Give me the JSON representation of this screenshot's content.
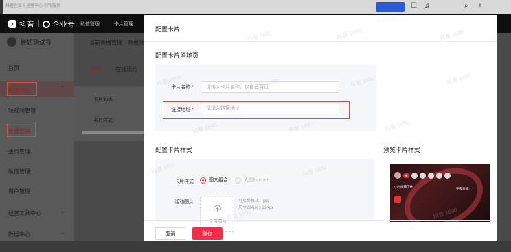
{
  "window": {
    "blurred_title": "抖音企业号运营中心-创作服务"
  },
  "topbar": {
    "app_name": "抖音",
    "product": "企业号",
    "nav": [
      "私信管理",
      "卡片管理"
    ]
  },
  "sidebar": {
    "account_name": "胖妞测试号",
    "items": [
      {
        "label": "首页"
      },
      {
        "label": "运营中心"
      },
      {
        "label": "短视频管理"
      },
      {
        "label": "直播管理"
      },
      {
        "label": "主页管理"
      },
      {
        "label": "私信管理"
      },
      {
        "label": "用户管理"
      },
      {
        "label": "经营工具中心"
      },
      {
        "label": "数据中心"
      }
    ]
  },
  "background_content": {
    "breadcrumb": [
      "当前直播管理",
      "直播预告"
    ],
    "tabs": [
      "通用",
      "在线预约"
    ],
    "card_list_title": "卡片列表",
    "card_style_title": "卡片样式"
  },
  "modal": {
    "title": "配置卡片",
    "landing_section_title": "配置卡片落地页",
    "fields": {
      "card_name": {
        "label": "卡片名称",
        "required": "*",
        "placeholder": "请输入卡片名称，仅自己可见"
      },
      "link": {
        "label": "链接地址",
        "required": "*",
        "placeholder": "请输入链接地址"
      }
    },
    "style_section_title": "配置卡片样式",
    "card_style_label": "卡片样式",
    "style_options": [
      "图文组合",
      "大图banner"
    ],
    "image_label": "活动图片",
    "upload_label": "上传图片",
    "upload_hint_1": "可接受格式：jpg",
    "upload_hint_2": "尺寸224px x 224px",
    "preview_title": "预览卡片样式",
    "preview_card": {
      "title": "小时候播了各",
      "more": "更多直播 ›"
    },
    "buttons": {
      "cancel": "取消",
      "save": "保存"
    }
  },
  "watermark_text": "抖音 1690",
  "colors": {
    "accent_red": "#f12f4a",
    "highlight_red": "#e8453c"
  }
}
